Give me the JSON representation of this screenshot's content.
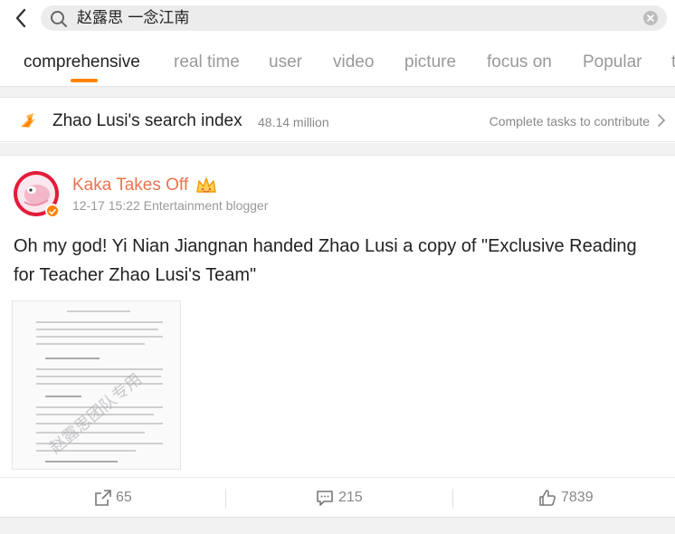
{
  "search": {
    "query": "赵露思 一念江南"
  },
  "tabs": [
    {
      "label": "comprehensive",
      "active": true
    },
    {
      "label": "real time",
      "active": false
    },
    {
      "label": "user",
      "active": false
    },
    {
      "label": "video",
      "active": false
    },
    {
      "label": "picture",
      "active": false
    },
    {
      "label": "focus on",
      "active": false
    },
    {
      "label": "Popular",
      "active": false
    },
    {
      "label": "t",
      "active": false
    }
  ],
  "search_index": {
    "title": "Zhao Lusi's search index",
    "value": "48.14 million",
    "contribute_label": "Complete tasks to contribute"
  },
  "post": {
    "username": "Kaka Takes Off",
    "meta": "12-17 15:22 Entertainment blogger",
    "text": "Oh my god! Yi Nian Jiangnan handed Zhao Lusi a copy of \"Exclusive Reading for Teacher Zhao Lusi's Team\"",
    "image_watermark": "赵露思团队专用",
    "actions": {
      "repost_count": "65",
      "comment_count": "215",
      "like_count": "7839"
    }
  },
  "colors": {
    "accent": "#ff8200",
    "username": "#eb7350",
    "avatar_ring": "#e31c3a"
  },
  "icons": [
    "back-arrow-icon",
    "search-icon",
    "clear-icon",
    "flame-icon",
    "chevron-right-icon",
    "verified-badge-icon",
    "crown-icon",
    "repost-icon",
    "comment-icon",
    "like-icon"
  ]
}
